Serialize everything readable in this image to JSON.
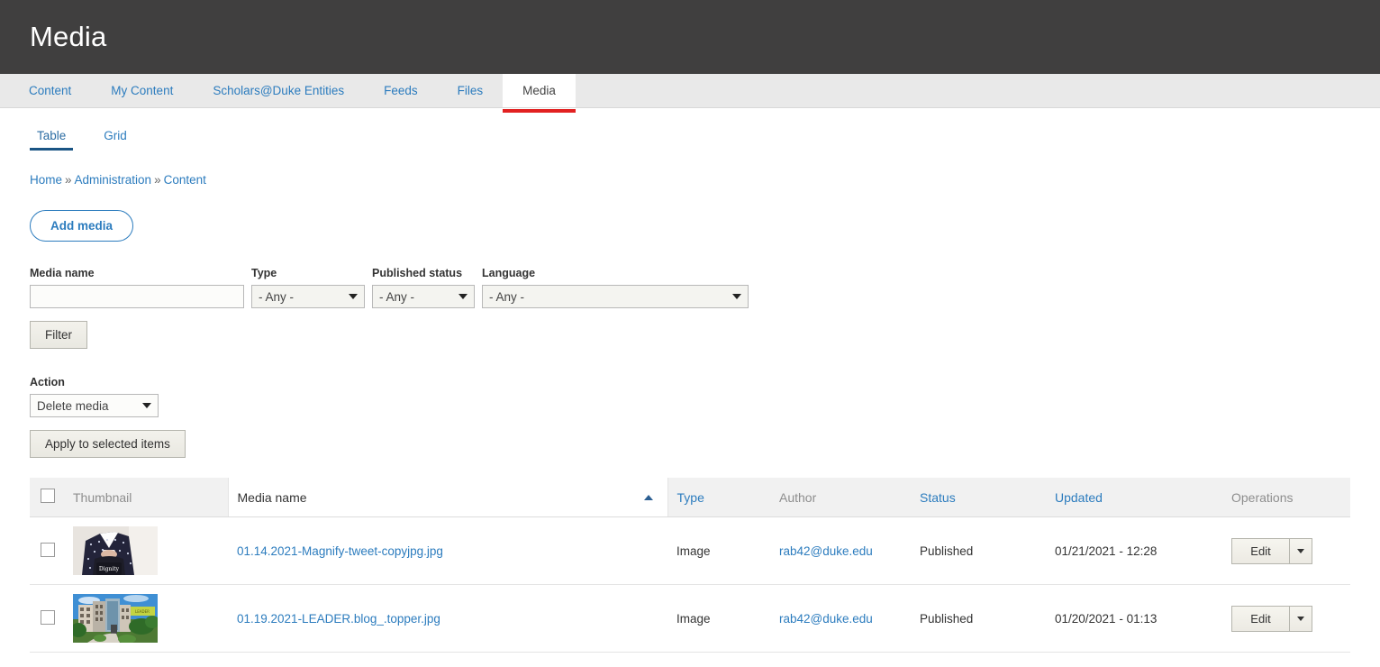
{
  "header": {
    "title": "Media"
  },
  "primary_tabs": [
    {
      "label": "Content",
      "active": false
    },
    {
      "label": "My Content",
      "active": false
    },
    {
      "label": "Scholars@Duke Entities",
      "active": false
    },
    {
      "label": "Feeds",
      "active": false
    },
    {
      "label": "Files",
      "active": false
    },
    {
      "label": "Media",
      "active": true
    }
  ],
  "secondary_tabs": [
    {
      "label": "Table",
      "active": true
    },
    {
      "label": "Grid",
      "active": false
    }
  ],
  "breadcrumb": {
    "items": [
      "Home",
      "Administration",
      "Content"
    ],
    "separator": "»"
  },
  "actions": {
    "add_media_label": "Add media"
  },
  "filters": {
    "media_name": {
      "label": "Media name",
      "value": "",
      "placeholder": ""
    },
    "type": {
      "label": "Type",
      "value": "- Any -"
    },
    "published_status": {
      "label": "Published status",
      "value": "- Any -"
    },
    "language": {
      "label": "Language",
      "value": "- Any -"
    },
    "filter_button": "Filter"
  },
  "bulk": {
    "label": "Action",
    "selected_action": "Delete media",
    "apply_button": "Apply to selected items"
  },
  "table": {
    "columns": [
      {
        "key": "select",
        "label": "",
        "sortable": false
      },
      {
        "key": "thumbnail",
        "label": "Thumbnail",
        "sortable": false
      },
      {
        "key": "name",
        "label": "Media name",
        "sortable": true,
        "sorted": "asc"
      },
      {
        "key": "type",
        "label": "Type",
        "sortable": true
      },
      {
        "key": "author",
        "label": "Author",
        "sortable": false
      },
      {
        "key": "status",
        "label": "Status",
        "sortable": true
      },
      {
        "key": "updated",
        "label": "Updated",
        "sortable": true
      },
      {
        "key": "operations",
        "label": "Operations",
        "sortable": false
      }
    ],
    "rows": [
      {
        "name": "01.14.2021-Magnify-tweet-copyjpg.jpg",
        "type": "Image",
        "author": "rab42@duke.edu",
        "status": "Published",
        "updated": "01/21/2021 - 12:28",
        "edit_label": "Edit",
        "thumbnail_alt": "person-in-polka-dot-suit-photo"
      },
      {
        "name": "01.19.2021-LEADER.blog_.topper.jpg",
        "type": "Image",
        "author": "rab42@duke.edu",
        "status": "Published",
        "updated": "01/20/2021 - 01:13",
        "edit_label": "Edit",
        "thumbnail_alt": "campus-building-photo"
      }
    ]
  },
  "colors": {
    "header_bg": "#403f3f",
    "link_blue": "#2c7cbe",
    "active_tab_underline": "#e22121",
    "subtab_underline": "#1a5484"
  }
}
